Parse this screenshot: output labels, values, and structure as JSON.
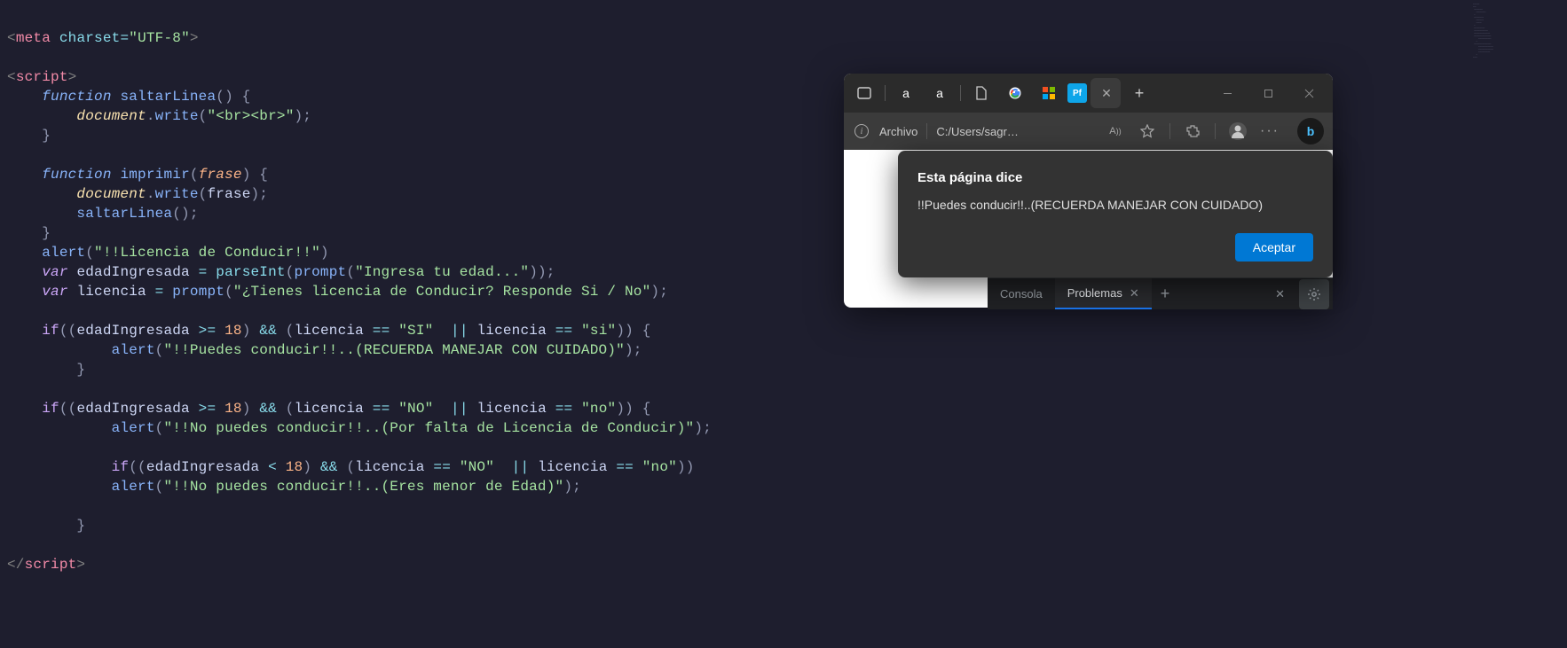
{
  "code": {
    "meta_tag": "meta",
    "charset_attr": "charset",
    "charset_val": "\"UTF-8\"",
    "script_tag": "script",
    "kw_function": "function",
    "fn_saltarLinea": "saltarLinea",
    "obj_document": "document",
    "fn_write": "write",
    "str_brbr": "\"<br><br>\"",
    "fn_imprimir": "imprimir",
    "param_frase": "frase",
    "fn_alert": "alert",
    "str_licencia_title": "\"!!Licencia de Conducir!!\"",
    "kw_var": "var",
    "var_edad": "edadIngresada",
    "fn_parseInt": "parseInt",
    "fn_prompt": "prompt",
    "str_ingresa_edad": "\"Ingresa tu edad...\"",
    "var_licencia": "licencia",
    "str_tienes_licencia": "\"¿Tienes licencia de Conducir? Responde Si / No\"",
    "kw_if": "if",
    "num_18": "18",
    "str_SI": "\"SI\"",
    "str_si": "\"si\"",
    "str_puedes": "\"!!Puedes conducir!!..(RECUERDA MANEJAR CON CUIDADO)\"",
    "str_NO": "\"NO\"",
    "str_no": "\"no\"",
    "str_no_puedes_lic": "\"!!No puedes conducir!!..(Por falta de Licencia de Conducir)\"",
    "str_no_puedes_edad": "\"!!No puedes conducir!!..(Eres menor de Edad)\"",
    "fn_saltarLinea_call": "saltarLinea"
  },
  "browser": {
    "tabs": {
      "a1": "a",
      "a2": "a"
    },
    "addr_label": "Archivo",
    "addr_path": "C:/Users/sagr…",
    "addr_aa": "A",
    "bing": "b"
  },
  "dialog": {
    "title": "Esta página dice",
    "message": "!!Puedes conducir!!..(RECUERDA MANEJAR CON CUIDADO)",
    "accept": "Aceptar"
  },
  "devtools": {
    "tab_consola": "Consola",
    "tab_problemas": "Problemas"
  }
}
